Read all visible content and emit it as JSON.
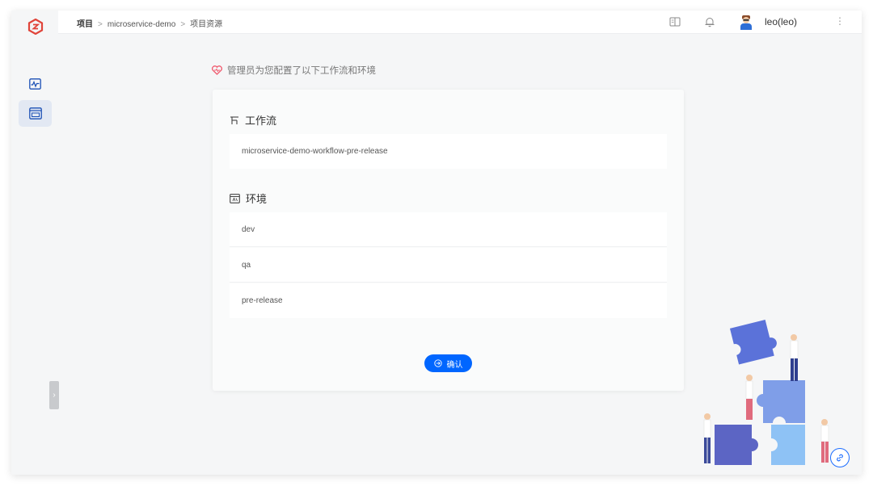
{
  "breadcrumb": {
    "root": "项目",
    "project": "microservice-demo",
    "current": "项目资源",
    "separator": ">"
  },
  "user": {
    "name": "leo(leo)"
  },
  "notice": {
    "text": "管理员为您配置了以下工作流和环境"
  },
  "workflow_section": {
    "title": "工作流",
    "items": [
      "microservice-demo-workflow-pre-release"
    ]
  },
  "env_section": {
    "title": "环境",
    "items": [
      "dev",
      "qa",
      "pre-release"
    ]
  },
  "confirm_button": {
    "label": "确认"
  },
  "colors": {
    "accent": "#0066ff",
    "sidebar_active": "#e2e8f3",
    "logo": "#e0443a",
    "heart": "#f05a6e"
  },
  "icons": {
    "logo": "zadig-logo",
    "monitor": "activity-monitor-icon",
    "resources": "project-resources-icon",
    "docs": "book-icon",
    "notifications": "bell-icon",
    "more": "vertical-ellipsis-icon",
    "notice": "heart-icon",
    "workflow": "workflow-icon",
    "env": "environment-icon",
    "confirm": "arrow-circle-icon",
    "collapse": "chevron-right-icon",
    "link": "link-icon"
  }
}
